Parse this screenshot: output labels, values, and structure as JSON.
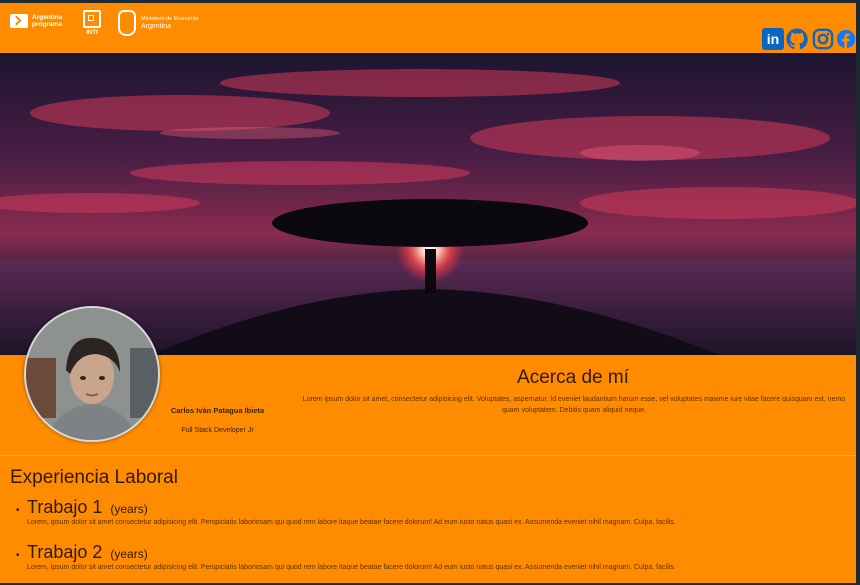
{
  "header": {
    "logos": {
      "argentina_programa": "Argentina programa",
      "inti": "INTI",
      "ministerio_line1": "Ministerio de Economía",
      "ministerio_line2": "Argentina"
    },
    "social": {
      "linkedin": "linkedin-icon",
      "github": "github-icon",
      "instagram": "instagram-icon",
      "facebook": "facebook-icon",
      "linkedin_label": "in"
    }
  },
  "banner": {
    "description_icon": "sunset-tree-image"
  },
  "profile": {
    "name": "Carlos Iván Patagua Ibieta",
    "role": "Full Stack Developer Jr"
  },
  "about": {
    "title": "Acerca de mí",
    "text": "Lorem ipsum dolor sit amet, consectetur adipisicing elit. Voluptates, aspernatur. Id eveniet laudantium harum esse, vel voluptates maxime iure vitae facere quisquam est, nemo quam voluptatem. Debitis quam aliquid neque."
  },
  "experience": {
    "title": "Experiencia Laboral",
    "jobs": [
      {
        "title": "Trabajo 1",
        "years": "(years)",
        "description": "Lorem, ipsum dolor sit amet consectetur adipisicing elit. Perspiciatis laboriosam qui quod rem labore itaque beatae facere dolorum! Ad eum iusto natus quasi ex. Assumenda eveniet nihil magnam. Culpa, facilis."
      },
      {
        "title": "Trabajo 2",
        "years": "(years)",
        "description": "Lorem, ipsum dolor sit amet consectetur adipisicing elit. Perspiciatis laboriosam qui quod rem labore itaque beatae facere dolorum! Ad eum iusto natus quasi ex. Assumenda eveniet nihil magnam. Culpa, facilis."
      }
    ]
  },
  "colors": {
    "accent": "#ff8c00",
    "linkedin": "#0a66c2",
    "facebook": "#1877f2"
  }
}
